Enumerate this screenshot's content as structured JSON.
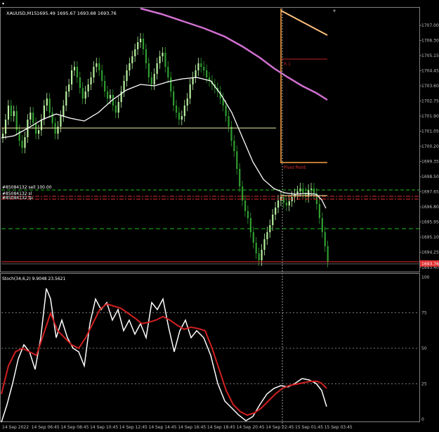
{
  "window": {
    "title": "XAUUSD,M15",
    "ohlc": "1695.49 1695.67 1693.68 1693.76",
    "indicator_label": "Stoch(34,6,2) 9.9048 23.5621",
    "order_label_1": "#85084132 sell 100.00",
    "order_label_2": "#85084132 sl",
    "order_label_3": "#85084132 tp",
    "current_price": "1693.76",
    "pivot_label": "Pivot Point",
    "r1_label": "R 1"
  },
  "price_axis": {
    "ticks": [
      "1707.00",
      "1706.30",
      "1705.15",
      "1704.45",
      "1703.60",
      "1702.75",
      "1701.90",
      "1701.05",
      "1700.20",
      "1699.35",
      "1698.50",
      "1697.65",
      "1696.80",
      "1695.95",
      "1695.10",
      "1694.25",
      "1693.40"
    ]
  },
  "stoch_axis": {
    "ticks": [
      "100",
      "75",
      "50",
      "25",
      "0"
    ]
  },
  "time_axis": {
    "ticks": [
      "14 Sep 2022",
      "14 Sep 06:45",
      "14 Sep 08:45",
      "14 Sep 10:45",
      "14 Sep 12:45",
      "14 Sep 14:45",
      "14 Sep 16:45",
      "14 Sep 18:45",
      "14 Sep 20:45",
      "14 Sep 22:45",
      "15 Sep 01:45",
      "15 Sep 03:45"
    ]
  },
  "colors": {
    "background": "#000000",
    "bull_candle": "#b8f0a0",
    "bear_candle": "#2f9e2f",
    "ma_fast": "#ffffff",
    "ma_slow": "#d070d0",
    "pivot_line": "#ffa040",
    "horizontal_yellow": "#f0f0a0",
    "stoch_main": "#ffffff",
    "stoch_signal": "#e02020",
    "current_price_bg": "#e03030"
  }
}
